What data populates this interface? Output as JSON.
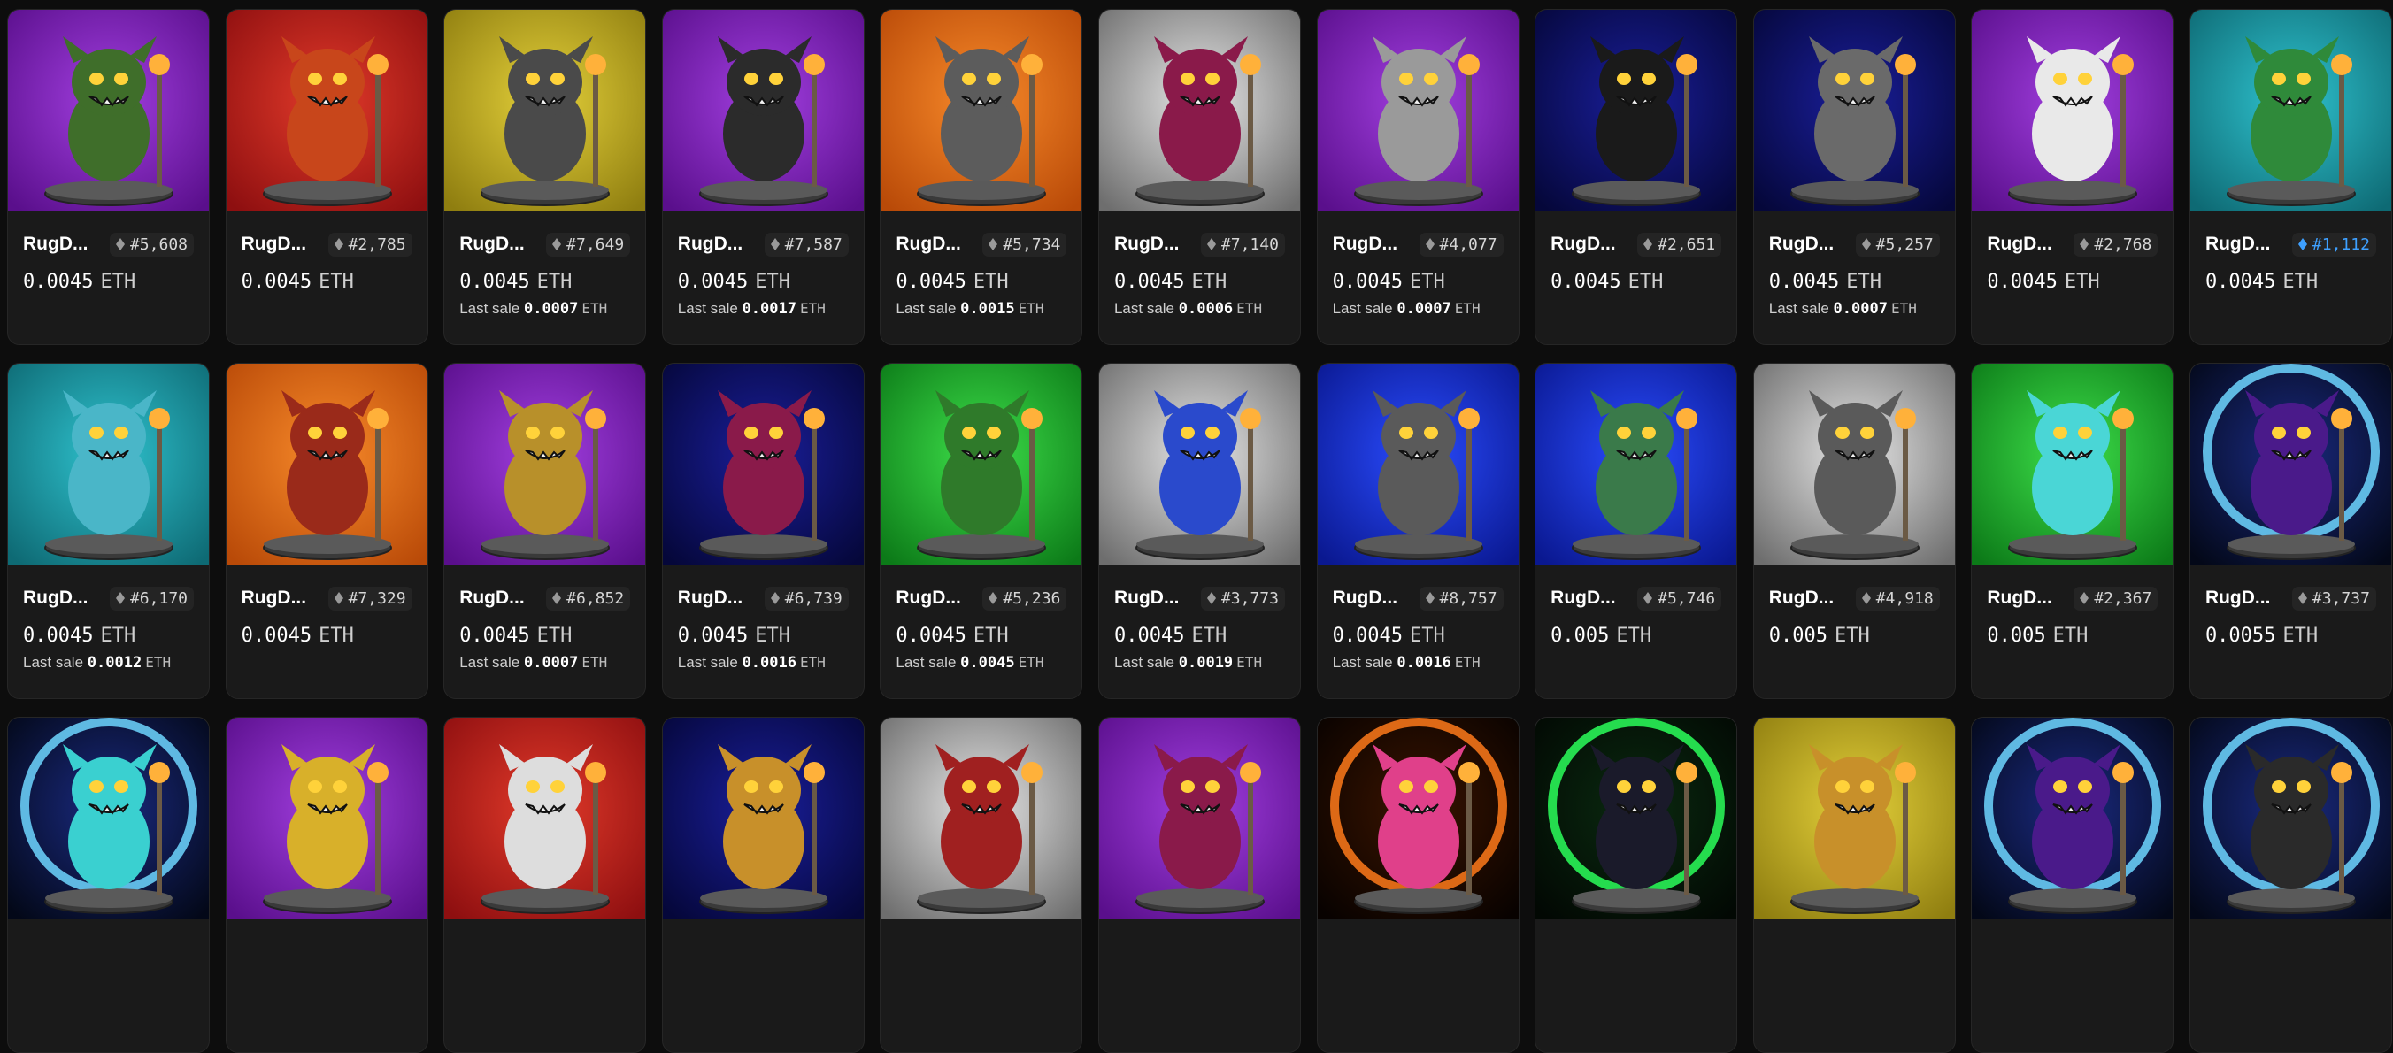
{
  "collection_prefix": "RugD...",
  "colors": {
    "purple": "#7b1fb4",
    "red": "#c81d1d",
    "yellow": "#c8b21e",
    "orange": "#e36b16",
    "gray": "#b8b8b8",
    "navy": "#0c1060",
    "teal": "#1a9aa6",
    "green": "#19b52c",
    "blue": "#1330d4",
    "fire": "#1a0a00",
    "darkgreen": "#041a08",
    "storm": "#0a1040"
  },
  "cards": [
    {
      "bg": "purple",
      "name": "RugD...",
      "token": "#5,608",
      "price": "0.0045",
      "currency": "ETH",
      "last_label": "",
      "last_value": "",
      "last_unit": ""
    },
    {
      "bg": "red",
      "name": "RugD...",
      "token": "#2,785",
      "price": "0.0045",
      "currency": "ETH",
      "last_label": "",
      "last_value": "",
      "last_unit": ""
    },
    {
      "bg": "yellow",
      "name": "RugD...",
      "token": "#7,649",
      "price": "0.0045",
      "currency": "ETH",
      "last_label": "Last sale",
      "last_value": "0.0007",
      "last_unit": "ETH"
    },
    {
      "bg": "purple",
      "name": "RugD...",
      "token": "#7,587",
      "price": "0.0045",
      "currency": "ETH",
      "last_label": "Last sale",
      "last_value": "0.0017",
      "last_unit": "ETH"
    },
    {
      "bg": "orange",
      "name": "RugD...",
      "token": "#5,734",
      "price": "0.0045",
      "currency": "ETH",
      "last_label": "Last sale",
      "last_value": "0.0015",
      "last_unit": "ETH"
    },
    {
      "bg": "gray",
      "name": "RugD...",
      "token": "#7,140",
      "price": "0.0045",
      "currency": "ETH",
      "last_label": "Last sale",
      "last_value": "0.0006",
      "last_unit": "ETH"
    },
    {
      "bg": "purple",
      "name": "RugD...",
      "token": "#4,077",
      "price": "0.0045",
      "currency": "ETH",
      "last_label": "Last sale",
      "last_value": "0.0007",
      "last_unit": "ETH"
    },
    {
      "bg": "navy",
      "name": "RugD...",
      "token": "#2,651",
      "price": "0.0045",
      "currency": "ETH",
      "last_label": "",
      "last_value": "",
      "last_unit": ""
    },
    {
      "bg": "navy",
      "name": "RugD...",
      "token": "#5,257",
      "price": "0.0045",
      "currency": "ETH",
      "last_label": "Last sale",
      "last_value": "0.0007",
      "last_unit": "ETH"
    },
    {
      "bg": "purple",
      "name": "RugD...",
      "token": "#2,768",
      "price": "0.0045",
      "currency": "ETH",
      "last_label": "",
      "last_value": "",
      "last_unit": ""
    },
    {
      "bg": "teal",
      "name": "RugD...",
      "token": "#1,112",
      "token_style": "blue",
      "price": "0.0045",
      "currency": "ETH",
      "last_label": "",
      "last_value": "",
      "last_unit": ""
    },
    {
      "bg": "teal",
      "name": "RugD...",
      "token": "#6,170",
      "price": "0.0045",
      "currency": "ETH",
      "last_label": "Last sale",
      "last_value": "0.0012",
      "last_unit": "ETH"
    },
    {
      "bg": "orange",
      "name": "RugD...",
      "token": "#7,329",
      "price": "0.0045",
      "currency": "ETH",
      "last_label": "",
      "last_value": "",
      "last_unit": ""
    },
    {
      "bg": "purple",
      "name": "RugD...",
      "token": "#6,852",
      "price": "0.0045",
      "currency": "ETH",
      "last_label": "Last sale",
      "last_value": "0.0007",
      "last_unit": "ETH"
    },
    {
      "bg": "navy",
      "name": "RugD...",
      "token": "#6,739",
      "price": "0.0045",
      "currency": "ETH",
      "last_label": "Last sale",
      "last_value": "0.0016",
      "last_unit": "ETH"
    },
    {
      "bg": "green",
      "name": "RugD...",
      "token": "#5,236",
      "price": "0.0045",
      "currency": "ETH",
      "last_label": "Last sale",
      "last_value": "0.0045",
      "last_unit": "ETH"
    },
    {
      "bg": "gray",
      "name": "RugD...",
      "token": "#3,773",
      "price": "0.0045",
      "currency": "ETH",
      "last_label": "Last sale",
      "last_value": "0.0019",
      "last_unit": "ETH"
    },
    {
      "bg": "blue",
      "name": "RugD...",
      "token": "#8,757",
      "price": "0.0045",
      "currency": "ETH",
      "last_label": "Last sale",
      "last_value": "0.0016",
      "last_unit": "ETH"
    },
    {
      "bg": "blue",
      "name": "RugD...",
      "token": "#5,746",
      "price": "0.005",
      "currency": "ETH",
      "last_label": "",
      "last_value": "",
      "last_unit": ""
    },
    {
      "bg": "gray",
      "name": "RugD...",
      "token": "#4,918",
      "price": "0.005",
      "currency": "ETH",
      "last_label": "",
      "last_value": "",
      "last_unit": ""
    },
    {
      "bg": "green",
      "name": "RugD...",
      "token": "#2,367",
      "price": "0.005",
      "currency": "ETH",
      "last_label": "",
      "last_value": "",
      "last_unit": ""
    },
    {
      "bg": "storm",
      "name": "RugD...",
      "token": "#3,737",
      "price": "0.0055",
      "currency": "ETH",
      "last_label": "",
      "last_value": "",
      "last_unit": ""
    },
    {
      "bg": "storm",
      "name": "",
      "token": "",
      "price": "",
      "currency": "",
      "last_label": "",
      "last_value": "",
      "last_unit": ""
    },
    {
      "bg": "purple",
      "name": "",
      "token": "",
      "price": "",
      "currency": "",
      "last_label": "",
      "last_value": "",
      "last_unit": ""
    },
    {
      "bg": "red",
      "name": "",
      "token": "",
      "price": "",
      "currency": "",
      "last_label": "",
      "last_value": "",
      "last_unit": ""
    },
    {
      "bg": "navy",
      "name": "",
      "token": "",
      "price": "",
      "currency": "",
      "last_label": "",
      "last_value": "",
      "last_unit": ""
    },
    {
      "bg": "gray",
      "name": "",
      "token": "",
      "price": "",
      "currency": "",
      "last_label": "",
      "last_value": "",
      "last_unit": ""
    },
    {
      "bg": "purple",
      "name": "",
      "token": "",
      "price": "",
      "currency": "",
      "last_label": "",
      "last_value": "",
      "last_unit": ""
    },
    {
      "bg": "fire",
      "name": "",
      "token": "",
      "price": "",
      "currency": "",
      "last_label": "",
      "last_value": "",
      "last_unit": ""
    },
    {
      "bg": "darkgreen",
      "name": "",
      "token": "",
      "price": "",
      "currency": "",
      "last_label": "",
      "last_value": "",
      "last_unit": ""
    },
    {
      "bg": "yellow",
      "name": "",
      "token": "",
      "price": "",
      "currency": "",
      "last_label": "",
      "last_value": "",
      "last_unit": ""
    },
    {
      "bg": "storm",
      "name": "",
      "token": "",
      "price": "",
      "currency": "",
      "last_label": "",
      "last_value": "",
      "last_unit": ""
    },
    {
      "bg": "storm",
      "name": "",
      "token": "",
      "price": "",
      "currency": "",
      "last_label": "",
      "last_value": "",
      "last_unit": ""
    }
  ]
}
